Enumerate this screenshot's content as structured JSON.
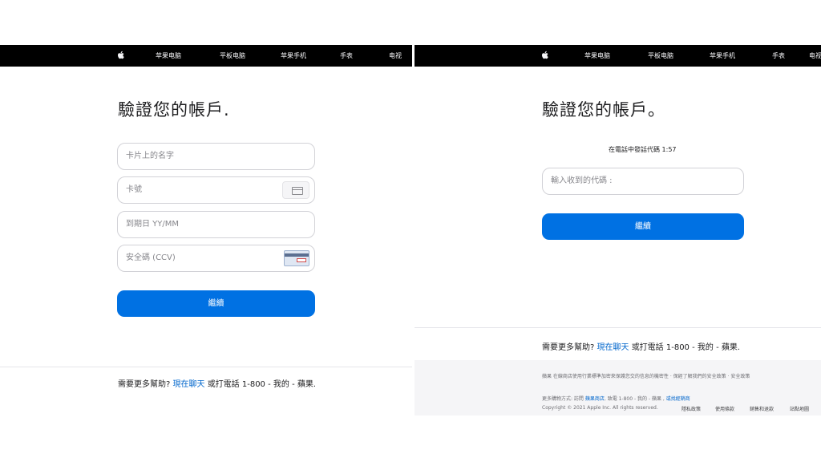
{
  "left": {
    "nav": [
      "苹果电脑",
      "平板电脑",
      "苹果手机",
      "手表",
      "电视"
    ],
    "title": "驗證您的帳戶.",
    "fields": {
      "name_placeholder": "卡片上的名字",
      "card_placeholder": "卡號",
      "expiry_placeholder": "到期日 YY/MM",
      "cvv_placeholder": "安全碼 (CCV)"
    },
    "continue_label": "繼續",
    "help": {
      "prefix": "需要更多幫助?",
      "chat": "現在聊天",
      "suffix": "或打電話 1-800 - 我的 - 蘋果."
    }
  },
  "right": {
    "nav": [
      "苹果电脑",
      "平板电脑",
      "苹果手机",
      "手表",
      "电视"
    ],
    "title": "驗證您的帳戶。",
    "code_hint": "在電話中發話代碼 1:57",
    "code_placeholder": "輸入收到的代碼 :",
    "continue_label": "繼續",
    "help": {
      "prefix": "需要更多幫助?",
      "chat": "現在聊天",
      "suffix": "或打電話 1-800 - 我的 - 蘋果."
    },
    "legal": {
      "notice": "蘋果 在線商店使用行業標準加密來保護您交的信息的機密性 · 保經了解我們的安全政策 · 安全政策",
      "more_prefix": "更多購物方式: 訪問",
      "store_link": "蘋果商店",
      "more_mid": ", 致電 1-800 - 我的 - 蘋果 , ",
      "reseller_link": "或找經銷商",
      "copyright": "Copyright © 2021 Apple Inc. All rights reserved.",
      "links": [
        "隱私政策",
        "使用條款",
        "銷售和退款",
        "站點地圖"
      ]
    }
  },
  "colors": {
    "accent": "#0071e3",
    "nav_bg": "#000000",
    "link": "#0066cc"
  },
  "icons": [
    "apple-logo-icon",
    "credit-card-icon",
    "cvv-card-icon"
  ]
}
